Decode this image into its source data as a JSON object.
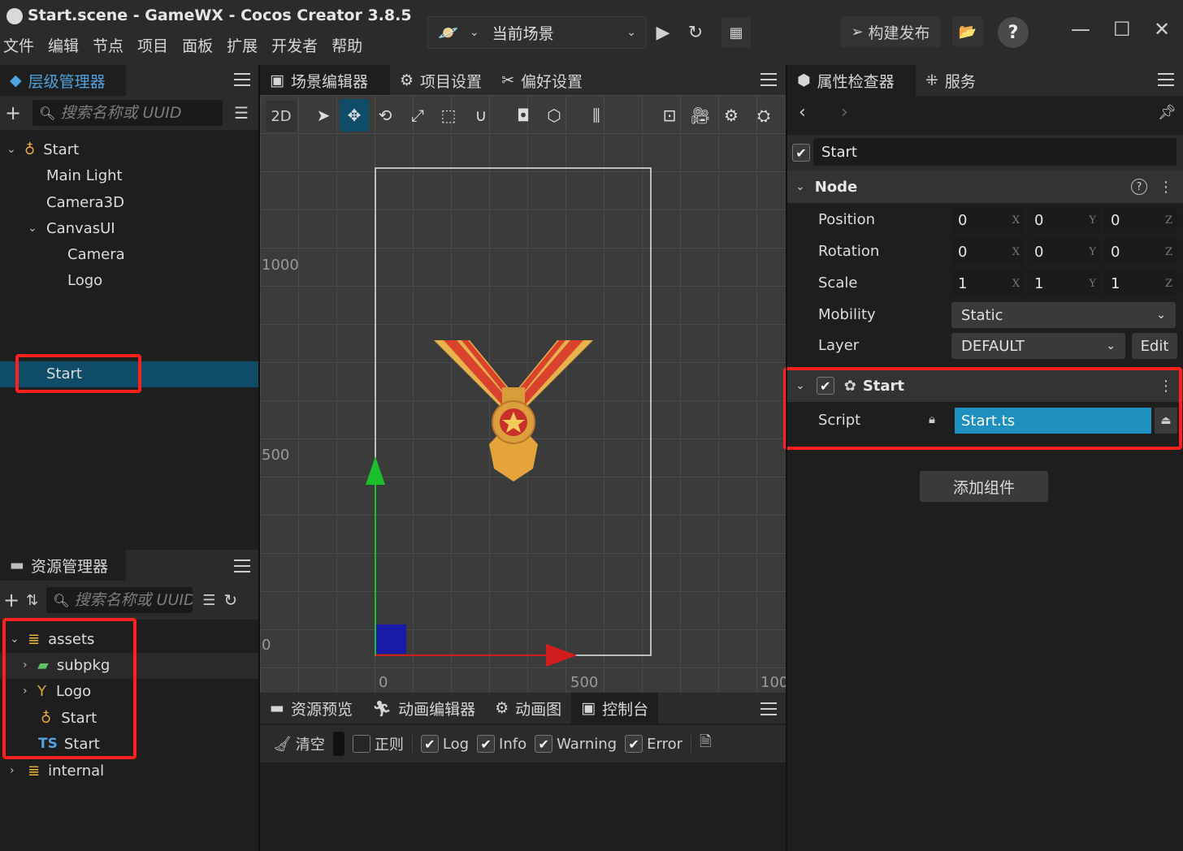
{
  "window": {
    "title": "Start.scene - GameWX - Cocos Creator 3.8.5",
    "menu": [
      "文件",
      "编辑",
      "节点",
      "项目",
      "面板",
      "扩展",
      "开发者",
      "帮助"
    ],
    "scene_select": "当前场景",
    "build_label": "构建发布"
  },
  "hierarchy": {
    "tab": "层级管理器",
    "search_placeholder": "搜索名称或 UUID",
    "items": [
      {
        "label": "Start"
      },
      {
        "label": "Main Light"
      },
      {
        "label": "Camera3D"
      },
      {
        "label": "CanvasUI"
      },
      {
        "label": "Camera"
      },
      {
        "label": "Logo"
      },
      {
        "label": "Start"
      }
    ]
  },
  "assets": {
    "tab": "资源管理器",
    "search_placeholder": "搜索名称或 UUID",
    "items": [
      {
        "label": "assets"
      },
      {
        "label": "subpkg"
      },
      {
        "label": "Logo"
      },
      {
        "label": "Start"
      },
      {
        "label": "Start",
        "badge": "TS"
      },
      {
        "label": "internal"
      }
    ]
  },
  "scene_editor": {
    "tabs": [
      "场景编辑器",
      "项目设置",
      "偏好设置"
    ],
    "mode_2d": "2D",
    "ruler_y": [
      "1000",
      "500",
      "0"
    ],
    "ruler_x": [
      "0",
      "500",
      "100"
    ]
  },
  "bottom": {
    "tabs": [
      "资源预览",
      "动画编辑器",
      "动画图",
      "控制台"
    ],
    "console": {
      "clear": "清空",
      "regex": "正则",
      "filters": [
        {
          "label": "Log",
          "checked": true
        },
        {
          "label": "Info",
          "checked": true
        },
        {
          "label": "Warning",
          "checked": true
        },
        {
          "label": "Error",
          "checked": true
        }
      ]
    }
  },
  "inspector": {
    "tabs": [
      "属性检查器",
      "服务"
    ],
    "node_name": "Start",
    "node_section": "Node",
    "props": {
      "position": {
        "label": "Position",
        "x": "0",
        "y": "0",
        "z": "0"
      },
      "rotation": {
        "label": "Rotation",
        "x": "0",
        "y": "0",
        "z": "0"
      },
      "scale": {
        "label": "Scale",
        "x": "1",
        "y": "1",
        "z": "1"
      },
      "mobility": {
        "label": "Mobility",
        "value": "Static"
      },
      "layer": {
        "label": "Layer",
        "value": "DEFAULT",
        "edit": "Edit"
      }
    },
    "component": {
      "name": "Start",
      "script_label": "Script",
      "script_value": "Start.ts"
    },
    "add_component": "添加组件",
    "axes": {
      "x": "X",
      "y": "Y",
      "z": "Z"
    }
  }
}
